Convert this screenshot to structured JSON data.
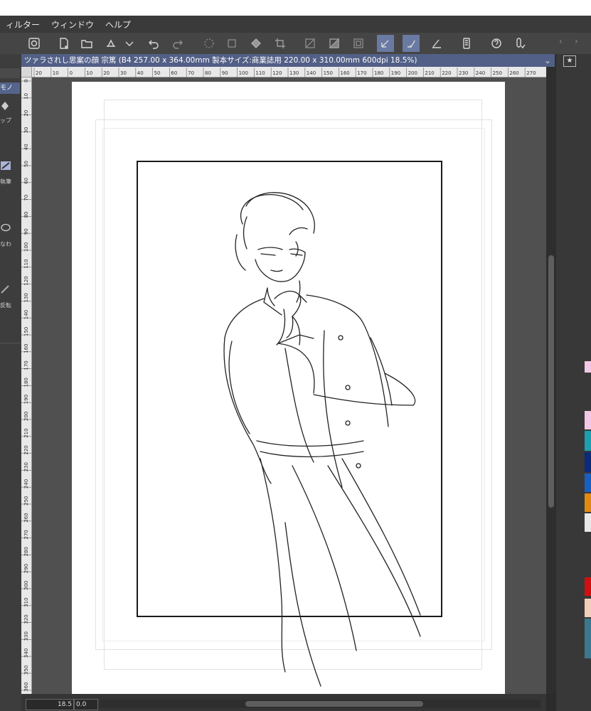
{
  "menu": {
    "items": [
      "ィルター",
      "ウィンドウ",
      "ヘルプ"
    ]
  },
  "document": {
    "tab_title": "ツァラされし思案の顔 宗篤 (B4 257.00 x 364.00mm 製本サイズ:商業誌用 220.00 x 310.00mm 600dpi 18.5%)"
  },
  "left_panel": {
    "selected_label": "モノ",
    "labels": [
      "ップ",
      "執筆",
      "なわ",
      "反転"
    ]
  },
  "ruler": {
    "h_ticks": [
      "20",
      "10",
      "0",
      "10",
      "20",
      "30",
      "40",
      "50",
      "60",
      "70",
      "80",
      "90",
      "100",
      "110",
      "120",
      "130",
      "140",
      "150",
      "160",
      "170",
      "180",
      "190",
      "200",
      "210",
      "220",
      "230",
      "240",
      "250",
      "260",
      "270"
    ],
    "v_ticks": [
      "0",
      "10",
      "20",
      "30",
      "40",
      "50",
      "60",
      "70",
      "80",
      "90",
      "100",
      "110",
      "120",
      "130",
      "140",
      "150",
      "160",
      "170",
      "180",
      "190",
      "200",
      "210",
      "220",
      "230",
      "240",
      "250",
      "260",
      "270",
      "280",
      "290",
      "300",
      "310",
      "320",
      "330",
      "340",
      "350",
      "360"
    ]
  },
  "status": {
    "zoom": "18.5",
    "rotation": "0.0"
  },
  "icons": {
    "toolbar": [
      "app-logo-icon",
      "new-file-icon",
      "open-file-icon",
      "save-icon",
      "chevron-down-icon",
      "undo-icon",
      "redo-icon",
      "loading-icon",
      "transform-icon",
      "fill-icon",
      "crop-icon",
      "snap-ruler-icon",
      "snap-special-ruler-icon",
      "snap-grid-icon",
      "pen-snap-icon",
      "curve-snap-icon",
      "perspective-snap-icon",
      "smartphone-icon",
      "companion-icon",
      "pen-settings-icon"
    ]
  },
  "colors": {
    "accent": "#55648c",
    "swatches": [
      "#f2c8e8",
      "#1aa0b0",
      "#0b2a7a",
      "#1860c0",
      "#e08a10",
      "#e8e8e8",
      "#d01010",
      "#f0d0b8",
      "#3a7890"
    ]
  }
}
